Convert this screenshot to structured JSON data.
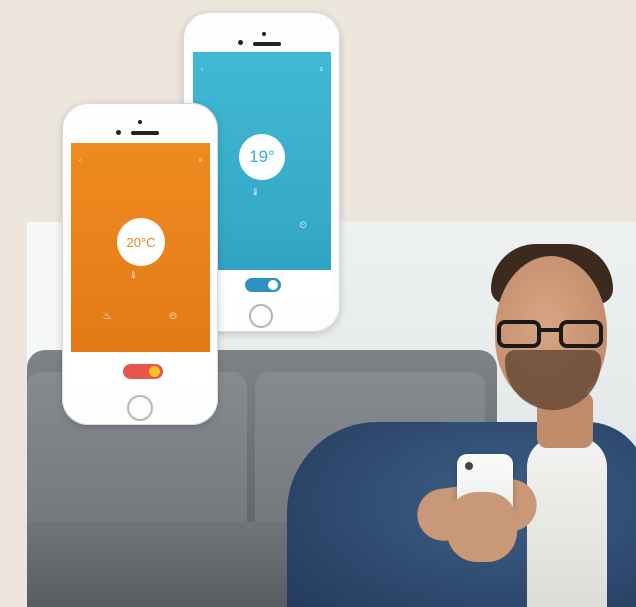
{
  "colors": {
    "background": "#ede6dc",
    "orange_screen": "#e8801c",
    "blue_screen": "#3cb2cf",
    "toggle_orange": "#e8554a",
    "toggle_blue": "#2d93bf"
  },
  "phone_front": {
    "header_title": "",
    "temperature": "20°C",
    "humidity": "",
    "mode_left": "",
    "mode_right": "",
    "switch_label": ""
  },
  "phone_back": {
    "header_title": "",
    "temperature": "19°",
    "humidity": "",
    "mode_left": "",
    "mode_right": "",
    "switch_label": ""
  },
  "icons": [
    "thermometer-icon",
    "steam-icon",
    "timer-icon",
    "back-arrow-icon",
    "menu-icon"
  ]
}
